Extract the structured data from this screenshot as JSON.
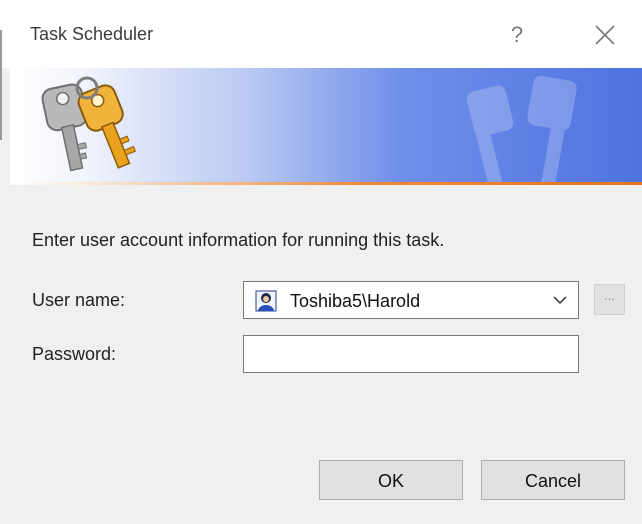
{
  "window": {
    "title": "Task Scheduler",
    "help_label": "?",
    "close_icon": "close-icon"
  },
  "banner": {
    "icon": "keys-icon",
    "colors": {
      "gradient_start": "#ffffff",
      "gradient_end": "#4f73e0",
      "accent_line": "#f08a3a"
    }
  },
  "form": {
    "instruction": "Enter user account information for running this task.",
    "user_label": "User name:",
    "user_value": "Toshiba5\\Harold",
    "user_icon": "user-account-icon",
    "browse_label": "...",
    "password_label": "Password:",
    "password_value": ""
  },
  "buttons": {
    "ok": "OK",
    "cancel": "Cancel"
  }
}
